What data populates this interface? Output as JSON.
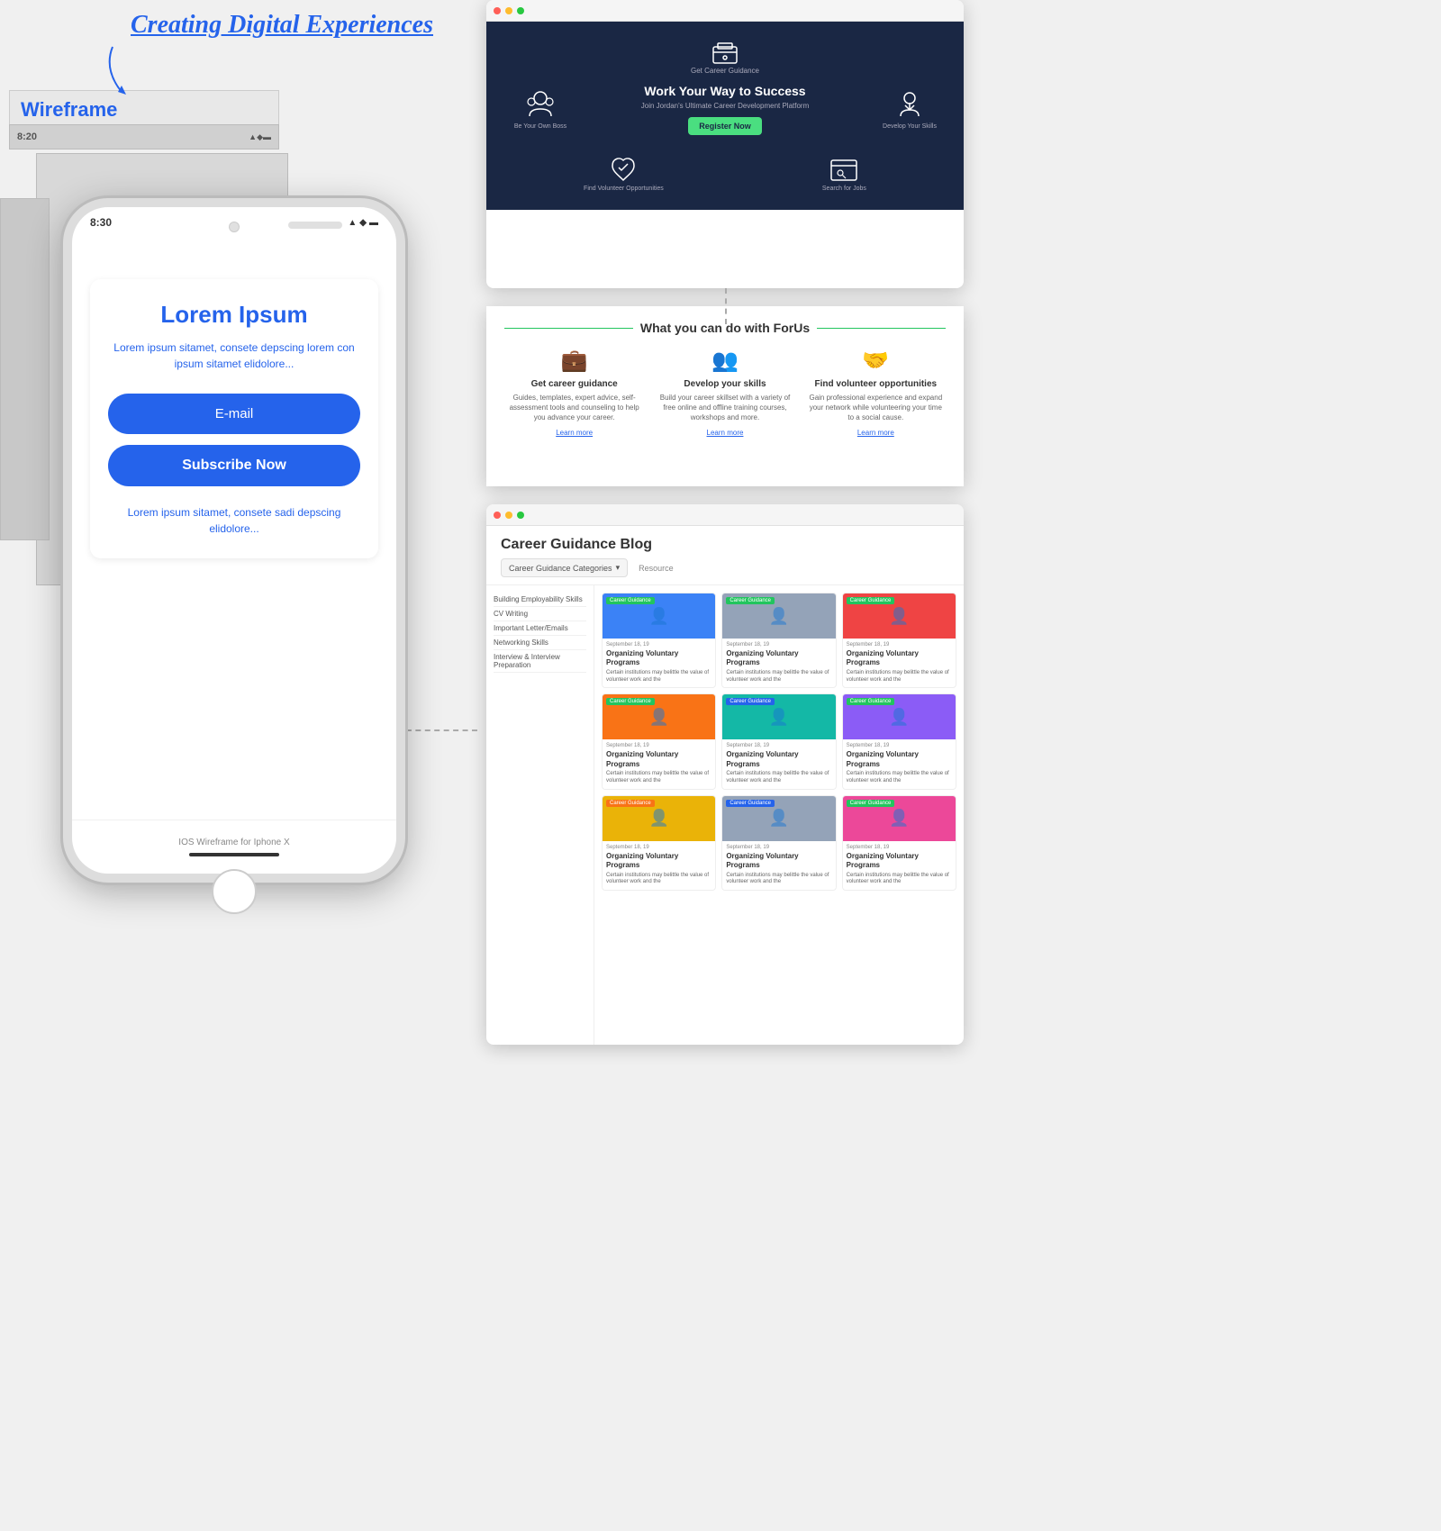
{
  "header": {
    "title": "Creating Digital Experiences"
  },
  "wireframe": {
    "label": "Wireframe",
    "status_time": "8:20",
    "iphone_time": "8:30",
    "lorem_title": "Lorem Ipsum",
    "lorem_desc": "Lorem ipsum sitamet, consete depscing lorem con ipsum sitamet elidolore...",
    "email_placeholder": "E-mail",
    "subscribe_btn": "Subscribe Now",
    "footer_text": "Lorem ipsum sitamet, consete sadi depscing elidolore...",
    "ios_label": "IOS Wireframe for Iphone X"
  },
  "website1": {
    "hero_title": "Work Your Way to Success",
    "hero_subtitle": "Join Jordan's Ultimate Career Development Platform",
    "register_btn": "Register Now",
    "top_icon_label": "Get Career Guidance",
    "left_icon_label": "Be Your Own Boss",
    "right_icon_label": "Develop Your Skills",
    "bottom_left_label": "Find Volunteer Opportunities",
    "bottom_right_label": "Search for Jobs"
  },
  "website2": {
    "section_title": "What you can do with ForUs",
    "cards": [
      {
        "icon": "💼",
        "title": "Get career guidance",
        "desc": "Guides, templates, expert advice, self-assessment tools and counseling to help you advance your career.",
        "link": "Learn more"
      },
      {
        "icon": "👥",
        "title": "Develop your skills",
        "desc": "Build your career skillset with a variety of free online and offline training courses, workshops and more.",
        "link": "Learn more"
      },
      {
        "icon": "🤝",
        "title": "Find volunteer opportunities",
        "desc": "Gain professional experience and expand your network while volunteering your time to a social cause.",
        "link": "Learn more"
      }
    ]
  },
  "blog": {
    "title": "Career Guidance Blog",
    "filter_label": "Career Guidance Categories",
    "resource_label": "Resource",
    "sidebar_items": [
      "Building Employability Skills",
      "CV Writing",
      "Important Letter/Emails",
      "Networking Skills",
      "Interview & Interview Preparation"
    ],
    "cards": [
      {
        "badge": "Career Guidance",
        "badge_color": "green",
        "date": "September 18, 19",
        "title": "Organizing Voluntary Programs",
        "desc": "Certain institutions may belittle the value of volunteer work and the",
        "img_color": "blue"
      },
      {
        "badge": "Career Guidance",
        "badge_color": "green",
        "date": "September 18, 19",
        "title": "Organizing Voluntary Programs",
        "desc": "Certain institutions may belittle the value of volunteer work and the",
        "img_color": "gray"
      },
      {
        "badge": "Career Guidance",
        "badge_color": "green",
        "date": "September 18, 19",
        "title": "Organizing Voluntary Programs",
        "desc": "Certain institutions may belittle the value of volunteer work and the",
        "img_color": "red"
      },
      {
        "badge": "Career Guidance",
        "badge_color": "green",
        "date": "September 18, 19",
        "title": "Organizing Voluntary Programs",
        "desc": "Certain institutions may belittle the value of volunteer work and the",
        "img_color": "orange"
      },
      {
        "badge": "Career Guidance",
        "badge_color": "blue",
        "date": "September 18, 19",
        "title": "Organizing Voluntary Programs",
        "desc": "Certain institutions may belittle the value of volunteer work and the",
        "img_color": "teal"
      },
      {
        "badge": "Career Guidance",
        "badge_color": "green",
        "date": "September 18, 19",
        "title": "Organizing Voluntary Programs",
        "desc": "Certain institutions may belittle the value of volunteer work and the",
        "img_color": "purple"
      },
      {
        "badge": "Career Guidance",
        "badge_color": "orange",
        "date": "September 18, 19",
        "title": "Organizing Voluntary Programs",
        "desc": "Certain institutions may belittle the value of volunteer work and the",
        "img_color": "yellow"
      },
      {
        "badge": "Career Guidance",
        "badge_color": "blue",
        "date": "September 18, 19",
        "title": "Organizing Voluntary Programs",
        "desc": "Certain institutions may belittle the value of volunteer work and the",
        "img_color": "gray"
      },
      {
        "badge": "Career Guidance",
        "badge_color": "green",
        "date": "September 18, 19",
        "title": "Organizing Voluntary Programs",
        "desc": "Certain institutions may belittle the value of volunteer work and the",
        "img_color": "pink"
      }
    ]
  }
}
